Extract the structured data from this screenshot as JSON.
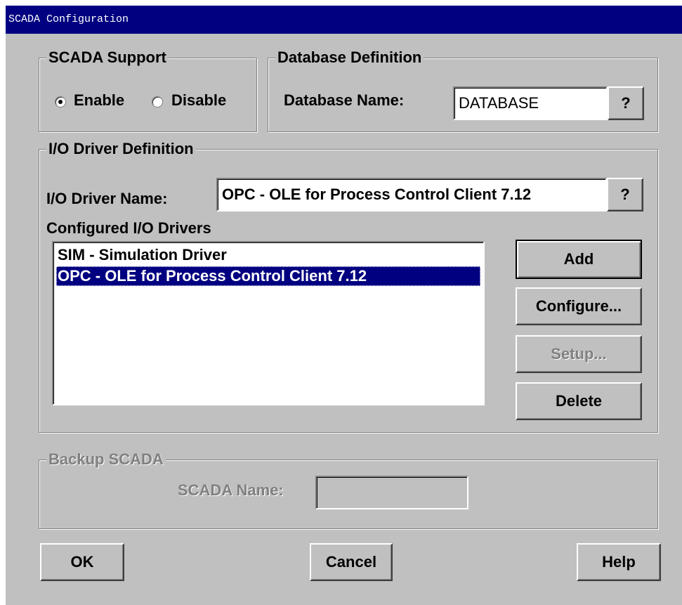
{
  "window": {
    "title": "SCADA Configuration"
  },
  "scada_support": {
    "legend": "SCADA Support",
    "enable_label": "Enable",
    "disable_label": "Disable",
    "selected": "Enable"
  },
  "database": {
    "legend": "Database Definition",
    "name_label": "Database Name:",
    "name_value": "DATABASE",
    "browse_label": "?"
  },
  "io_driver": {
    "legend": "I/O Driver Definition",
    "name_label": "I/O Driver Name:",
    "name_value": "OPC - OLE for Process Control Client  7.12",
    "browse_label": "?",
    "configured_label": "Configured I/O Drivers",
    "drivers": [
      {
        "label": "SIM - Simulation Driver",
        "selected": false
      },
      {
        "label": "OPC - OLE for Process Control Client  7.12",
        "selected": true
      }
    ],
    "buttons": {
      "add": "Add",
      "configure": "Configure...",
      "setup": "Setup...",
      "delete": "Delete"
    }
  },
  "backup": {
    "legend": "Backup SCADA",
    "name_label": "SCADA Name:",
    "name_value": ""
  },
  "footer": {
    "ok": "OK",
    "cancel": "Cancel",
    "help": "Help"
  }
}
